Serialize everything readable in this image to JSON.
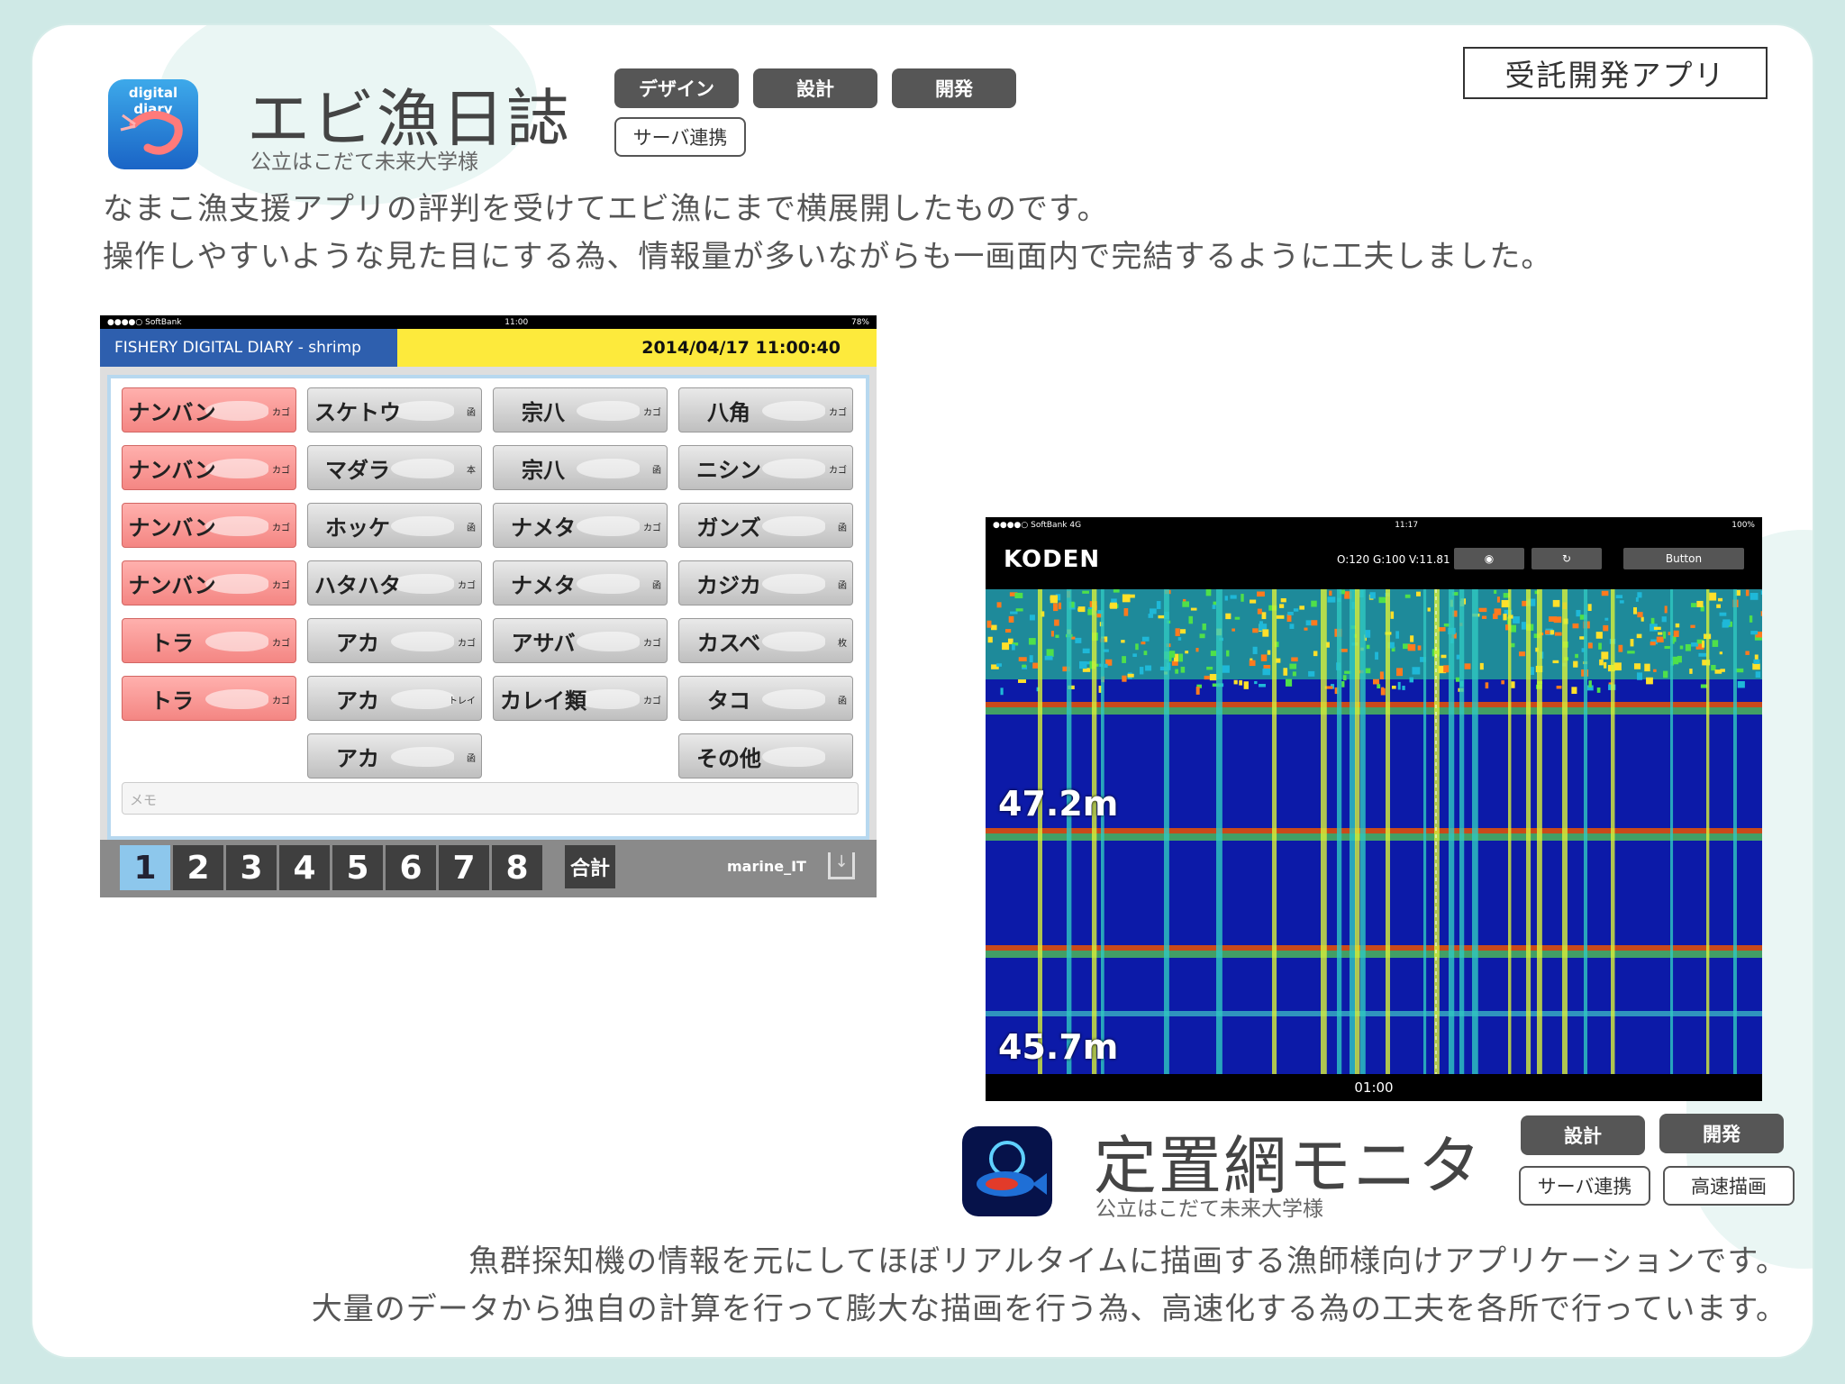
{
  "top_app": {
    "title": "エビ漁日誌",
    "client": "公立はこだて未来大学様",
    "icon_label": "digital diary",
    "tags": [
      "デザイン",
      "設計",
      "開発",
      "サーバ連携"
    ],
    "contract_label": "受託開発アプリ",
    "description": [
      "なまこ漁支援アプリの評判を受けてエビ漁にまで横展開したものです。",
      "操作しやすいような見た目にする為、情報量が多いながらも一画面内で完結するように工夫しました。"
    ]
  },
  "shrimp_screen": {
    "status_left": "●●●●○ SoftBank",
    "status_time": "11:00",
    "status_right": "78%",
    "header_title": "FISHERY DIGITAL DIARY - shrimp",
    "header_datetime": "2014/04/17  11:00:40",
    "buttons": [
      {
        "label": "ナンバン",
        "unit": "カゴ",
        "color": "red"
      },
      {
        "label": "スケトウ",
        "unit": "函",
        "color": "gray"
      },
      {
        "label": "宗八",
        "unit": "カゴ",
        "color": "gray"
      },
      {
        "label": "八角",
        "unit": "カゴ",
        "color": "gray"
      },
      {
        "label": "ナンバン",
        "unit": "カゴ",
        "color": "red"
      },
      {
        "label": "マダラ",
        "unit": "本",
        "color": "gray"
      },
      {
        "label": "宗八",
        "unit": "函",
        "color": "gray"
      },
      {
        "label": "ニシン",
        "unit": "カゴ",
        "color": "gray"
      },
      {
        "label": "ナンバン",
        "unit": "カゴ",
        "color": "red"
      },
      {
        "label": "ホッケ",
        "unit": "函",
        "color": "gray"
      },
      {
        "label": "ナメタ",
        "unit": "カゴ",
        "color": "gray"
      },
      {
        "label": "ガンズ",
        "unit": "函",
        "color": "gray"
      },
      {
        "label": "ナンバン",
        "unit": "カゴ",
        "color": "red"
      },
      {
        "label": "ハタハタ",
        "unit": "カゴ",
        "color": "gray"
      },
      {
        "label": "ナメタ",
        "unit": "函",
        "color": "gray"
      },
      {
        "label": "カジカ",
        "unit": "函",
        "color": "gray"
      },
      {
        "label": "トラ",
        "unit": "カゴ",
        "color": "red"
      },
      {
        "label": "アカ",
        "unit": "カゴ",
        "color": "gray"
      },
      {
        "label": "アサバ",
        "unit": "カゴ",
        "color": "gray"
      },
      {
        "label": "カスベ",
        "unit": "枚",
        "color": "gray"
      },
      {
        "label": "トラ",
        "unit": "カゴ",
        "color": "red"
      },
      {
        "label": "アカ",
        "unit": "トレイ",
        "color": "gray"
      },
      {
        "label": "カレイ類",
        "unit": "カゴ",
        "color": "gray"
      },
      {
        "label": "タコ",
        "unit": "函",
        "color": "gray"
      },
      {
        "label": "アカ",
        "unit": "函",
        "color": "gray"
      },
      {
        "label": "その他",
        "unit": "",
        "color": "gray"
      }
    ],
    "memo_placeholder": "メモ",
    "pages": [
      "1",
      "2",
      "3",
      "4",
      "5",
      "6",
      "7",
      "8"
    ],
    "active_page": "1",
    "total_label": "合計",
    "brand": "marine_IT"
  },
  "sonar_screen": {
    "status_left": "●●●●○ SoftBank  4G",
    "status_time": "11:17",
    "status_right": "100%",
    "logo": "KODEN",
    "readout": "O:120 G:100 V:11.81",
    "button_label": "Button",
    "depth_labels": [
      "47.2m",
      "45.7m"
    ],
    "time_label": "01:00"
  },
  "bottom_app": {
    "title": "定置網モニタ",
    "client": "公立はこだて未来大学様",
    "tags": [
      "設計",
      "開発",
      "サーバ連携",
      "高速描画"
    ],
    "description": [
      "魚群探知機の情報を元にしてほぼリアルタイムに描画する漁師様向けアプリケーションです。",
      "大量のデータから独自の計算を行って膨大な描画を行う為、高速化する為の工夫を各所で行っています。"
    ]
  },
  "colors": {
    "tag_dark": "#565656",
    "header_blue": "#2e5fae",
    "header_yellow": "#fdea3c",
    "red_button": "#f48683",
    "active_page": "#8dc7ec",
    "sonar_bg": "#0c1aa8"
  }
}
